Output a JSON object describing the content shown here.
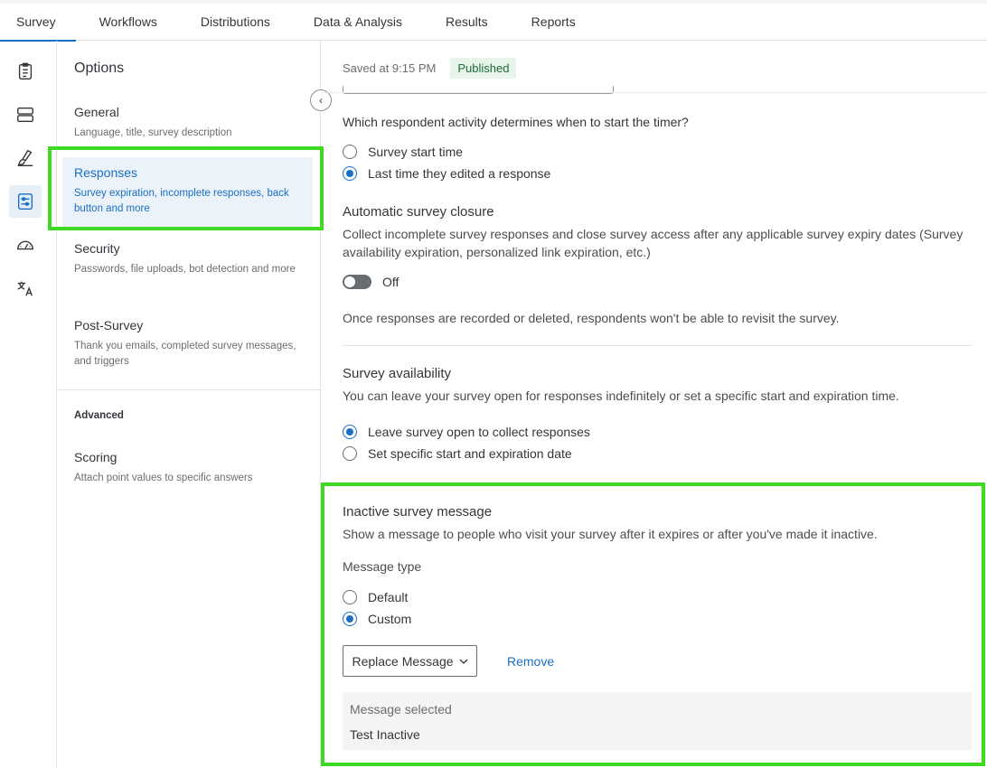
{
  "topnav": {
    "tabs": [
      {
        "label": "Survey"
      },
      {
        "label": "Workflows"
      },
      {
        "label": "Distributions"
      },
      {
        "label": "Data & Analysis"
      },
      {
        "label": "Results"
      },
      {
        "label": "Reports"
      }
    ]
  },
  "rail": {
    "icons": [
      "survey-clipboard-icon",
      "layout-icon",
      "brush-icon",
      "options-sliders-icon",
      "dashboard-gauge-icon",
      "translate-icon"
    ],
    "expand_icon": "›"
  },
  "options": {
    "title": "Options",
    "collapse_icon": "‹",
    "items": [
      {
        "title": "General",
        "desc": "Language, title, survey description"
      },
      {
        "title": "Responses",
        "desc": "Survey expiration, incomplete responses, back button and more"
      },
      {
        "title": "Security",
        "desc": "Passwords, file uploads, bot detection and more"
      },
      {
        "title": "Post-Survey",
        "desc": "Thank you emails, completed survey messages, and triggers"
      }
    ],
    "advanced_label": "Advanced",
    "advanced_items": [
      {
        "title": "Scoring",
        "desc": "Attach point values to specific answers"
      }
    ]
  },
  "status": {
    "saved": "Saved at 9:15 PM",
    "badge": "Published"
  },
  "timer": {
    "question": "Which respondent activity determines when to start the timer?",
    "options": [
      "Survey start time",
      "Last time they edited a response"
    ],
    "selected": 1
  },
  "closure": {
    "title": "Automatic survey closure",
    "desc": "Collect incomplete survey responses and close survey access after any applicable survey expiry dates (Survey availability expiration, personalized link expiration, etc.)",
    "toggle_label": "Off",
    "note": "Once responses are recorded or deleted, respondents won't be able to revisit the survey."
  },
  "availability": {
    "title": "Survey availability",
    "desc": "You can leave your survey open for responses indefinitely or set a specific start and expiration time.",
    "options": [
      "Leave survey open to collect responses",
      "Set specific start and expiration date"
    ],
    "selected": 0
  },
  "inactive": {
    "title": "Inactive survey message",
    "desc": "Show a message to people who visit your survey after it expires or after you've made it inactive.",
    "type_label": "Message type",
    "options": [
      "Default",
      "Custom"
    ],
    "selected": 1,
    "replace_label": "Replace Message",
    "remove_label": "Remove",
    "selected_label": "Message selected",
    "selected_value": "Test Inactive"
  },
  "colors": {
    "accent": "#1a6fc4",
    "highlight": "#3fd823",
    "badge_bg": "#e6f4ea"
  }
}
